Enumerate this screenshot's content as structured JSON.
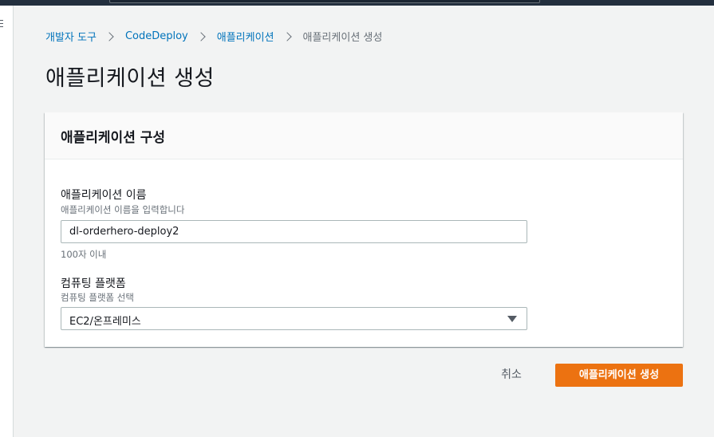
{
  "breadcrumb": {
    "items": [
      "개발자 도구",
      "CodeDeploy",
      "애플리케이션"
    ],
    "current": "애플리케이션 생성"
  },
  "page": {
    "title": "애플리케이션 생성"
  },
  "panel": {
    "title": "애플리케이션 구성",
    "name_field": {
      "label": "애플리케이션 이름",
      "description": "애플리케이션 이름을 입력합니다",
      "value": "dl-orderhero-deploy2",
      "constraint": "100자 이내"
    },
    "platform_field": {
      "label": "컴퓨팅 플랫폼",
      "description": "컴퓨팅 플랫폼 선택",
      "selected": "EC2/온프레미스"
    }
  },
  "actions": {
    "cancel_label": "취소",
    "create_label": "애플리케이션 생성"
  },
  "colors": {
    "primary": "#ec7211",
    "link": "#0073bb",
    "topbar": "#232f3e"
  },
  "icons": {
    "menu": "hamburger-menu-icon",
    "breadcrumb_separator": "chevron-right-icon",
    "select_caret": "caret-down-icon"
  }
}
